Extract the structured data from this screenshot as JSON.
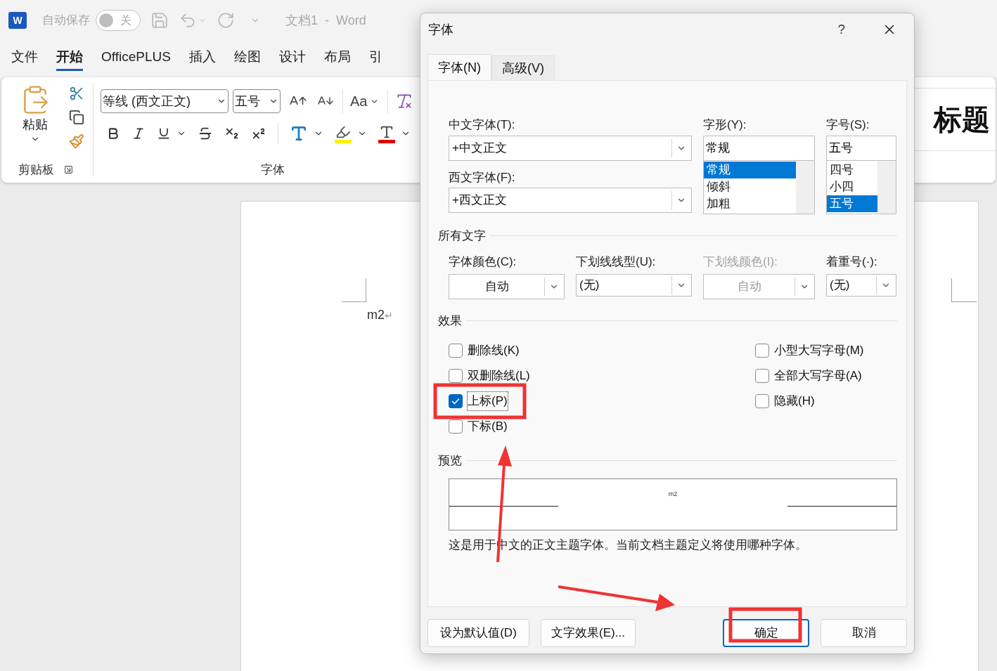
{
  "word": {
    "title_bar": {
      "logo_letter": "W",
      "autosave_label": "自动保存",
      "autosave_toggle": {
        "label": "关",
        "on": false
      },
      "document_title": "文档1  -  Word"
    },
    "menu_tabs": [
      {
        "label": "文件",
        "selected": false
      },
      {
        "label": "开始",
        "selected": true
      },
      {
        "label": "OfficePLUS",
        "selected": false
      },
      {
        "label": "插入",
        "selected": false
      },
      {
        "label": "绘图",
        "selected": false
      },
      {
        "label": "设计",
        "selected": false
      },
      {
        "label": "布局",
        "selected": false
      },
      {
        "label": "引",
        "selected": false
      }
    ],
    "ribbon": {
      "clipboard": {
        "paste_label": "粘贴",
        "group_label": "剪贴板"
      },
      "font": {
        "font_name": "等线 (西文正文)",
        "font_size": "五号",
        "change_case": "Aa",
        "group_label": "字体"
      },
      "styles": {
        "style_name": "标题"
      }
    },
    "document": {
      "text": "m2",
      "paragraph_mark": "↵"
    }
  },
  "dialog": {
    "title": "字体",
    "help": "?",
    "tabs": [
      {
        "label": "字体(N)",
        "selected": true
      },
      {
        "label": "高级(V)",
        "selected": false
      }
    ],
    "chinese_font": {
      "label": "中文字体(T):",
      "value": "+中文正文"
    },
    "western_font": {
      "label": "西文字体(F):",
      "value": "+西文正文"
    },
    "font_style": {
      "label": "字形(Y):",
      "value": "常规",
      "options": [
        {
          "label": "常规",
          "selected": true
        },
        {
          "label": "倾斜",
          "selected": false
        },
        {
          "label": "加粗",
          "selected": false
        }
      ]
    },
    "font_size": {
      "label": "字号(S):",
      "value": "五号",
      "options": [
        {
          "label": "四号",
          "selected": false
        },
        {
          "label": "小四",
          "selected": false
        },
        {
          "label": "五号",
          "selected": true
        }
      ]
    },
    "all_text": {
      "heading": "所有文字",
      "fields": [
        {
          "label": "字体颜色(C):",
          "value": "自动",
          "kind": "color",
          "disabled": false
        },
        {
          "label": "下划线线型(U):",
          "value": "(无)",
          "kind": "list",
          "disabled": false
        },
        {
          "label": "下划线颜色(I):",
          "value": "自动",
          "kind": "color",
          "disabled": true
        },
        {
          "label": "着重号(·):",
          "value": "(无)",
          "kind": "list",
          "disabled": false
        }
      ]
    },
    "effects": {
      "heading": "效果",
      "left": [
        {
          "label": "删除线(K)",
          "checked": false
        },
        {
          "label": "双删除线(L)",
          "checked": false
        },
        {
          "label": "上标(P)",
          "checked": true
        },
        {
          "label": "下标(B)",
          "checked": false
        }
      ],
      "right": [
        {
          "label": "小型大写字母(M)",
          "checked": false
        },
        {
          "label": "全部大写字母(A)",
          "checked": false
        },
        {
          "label": "隐藏(H)",
          "checked": false
        }
      ]
    },
    "preview": {
      "heading": "预览",
      "sample": "m2",
      "description": "这是用于中文的正文主题字体。当前文档主题定义将使用哪种字体。"
    },
    "left_buttons": [
      {
        "label": "设为默认值(D)",
        "default": false
      },
      {
        "label": "文字效果(E)...",
        "default": false
      }
    ],
    "right_buttons": [
      {
        "label": "确定",
        "default": true
      },
      {
        "label": "取消",
        "default": false
      }
    ]
  }
}
